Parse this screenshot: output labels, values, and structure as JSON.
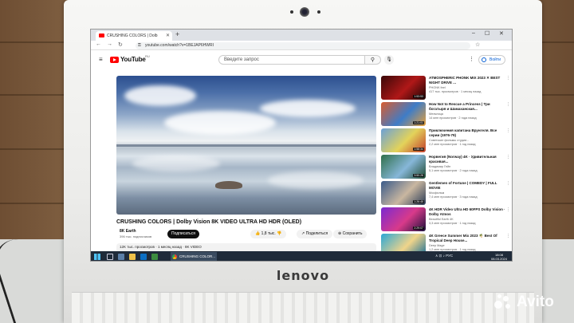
{
  "browser": {
    "tab_title": "CRUSHING COLORS | Dolb",
    "url": "youtube.com/watch?v=1BEJAP6HWRI",
    "new_tab": "+",
    "min": "–",
    "max": "☐",
    "close": "✕"
  },
  "youtube": {
    "logo_text": "YouTube",
    "country": "RU",
    "search_placeholder": "Введите запрос",
    "search_icon": "⚲",
    "mic_icon": "🎙",
    "menu_icon": "≡",
    "more_icon": "⋮",
    "signin": "Войти"
  },
  "video": {
    "title": "CRUSHING COLORS | Dolby Vision 8K VIDEO ULTRA HD HDR (OLED)",
    "channel": "8K Earth",
    "subscribers": "396 тыс. подписчиков",
    "subscribe": "Подписаться",
    "likes": "1,8 тыс.",
    "share": "Поделиться",
    "save": "Сохранить",
    "description": "12K тыс. просмотров · 1 месяц назад · 8K VIDEO"
  },
  "sidebar": [
    {
      "title": "ATMOSPHERIC PHONK MIX 2023 ✕ BEST NIGHT DRIVE ...",
      "channel": "PHONK feel",
      "meta": "417 тыс. просмотров · 1 месяц назад",
      "duration": "1:53:53",
      "colors": [
        "#3a0808",
        "#b01818",
        "#1a0303"
      ]
    },
    {
      "title": "How Not to Rescue a Princess | Три богатыря и Шамаханская...",
      "channel": "Мельница",
      "meta": "14 млн просмотров · 2 года назад",
      "duration": "1:21:01",
      "colors": [
        "#d95c2e",
        "#3e7cc7",
        "#e8a13a"
      ]
    },
    {
      "title": "Приключения капитана Врунгеля. Все серии (1976-79)",
      "channel": "Советские фильмы студии...",
      "meta": "2,2 млн просмотров · 1 год назад",
      "duration": "1:58:34",
      "colors": [
        "#6aa0d8",
        "#e3d35a",
        "#c23d2a"
      ]
    },
    {
      "title": "Норвегия (Norway) 4K · Удивительная красивая...",
      "channel": "Владимир Гейн",
      "meta": "5,1 млн просмотров · 2 года назад",
      "duration": "3:50:28",
      "colors": [
        "#2f6f4a",
        "#87b7d9",
        "#1f4a30"
      ]
    },
    {
      "title": "Gentlemen of Fortune | COMEDY | FULL MOVIE",
      "channel": "Мосфильм",
      "meta": "7,4 млн просмотров · 3 года назад",
      "duration": "1:26:45",
      "colors": [
        "#3a5a8a",
        "#c9b7a0",
        "#2a3a55"
      ]
    },
    {
      "title": "4K HDR Video Ultra HD 60FPS Dolby Vision · Dolby Atmos",
      "channel": "Beautiful Earth 4K",
      "meta": "3,3 млн просмотров · 1 год назад",
      "duration": "2:29:07",
      "colors": [
        "#7a2ad1",
        "#d83a8a",
        "#1b0f3a"
      ]
    },
    {
      "title": "4K Greece Summer Mix 2023 🌴 Best Of Tropical Deep House...",
      "channel": "Deep Mage",
      "meta": "1,2 млн просмотров · 1 год назад",
      "duration": "1:32:28",
      "colors": [
        "#2aa6d6",
        "#f0d48a",
        "#0e6a9a"
      ]
    }
  ],
  "taskbar": {
    "task_label": "CRUSHING COLOR...",
    "tray": "∧  ⊡  ♪  РУС",
    "time": "18:08",
    "date": "08.03.2024"
  },
  "device": {
    "brand": "lenovo"
  },
  "watermark": {
    "text": "Avito"
  },
  "icons": {
    "back": "←",
    "forward": "→",
    "reload": "↻",
    "lock": "⚿",
    "star": "☆",
    "like": "👍",
    "dislike": "👎",
    "share": "↗",
    "save": "⊕"
  }
}
